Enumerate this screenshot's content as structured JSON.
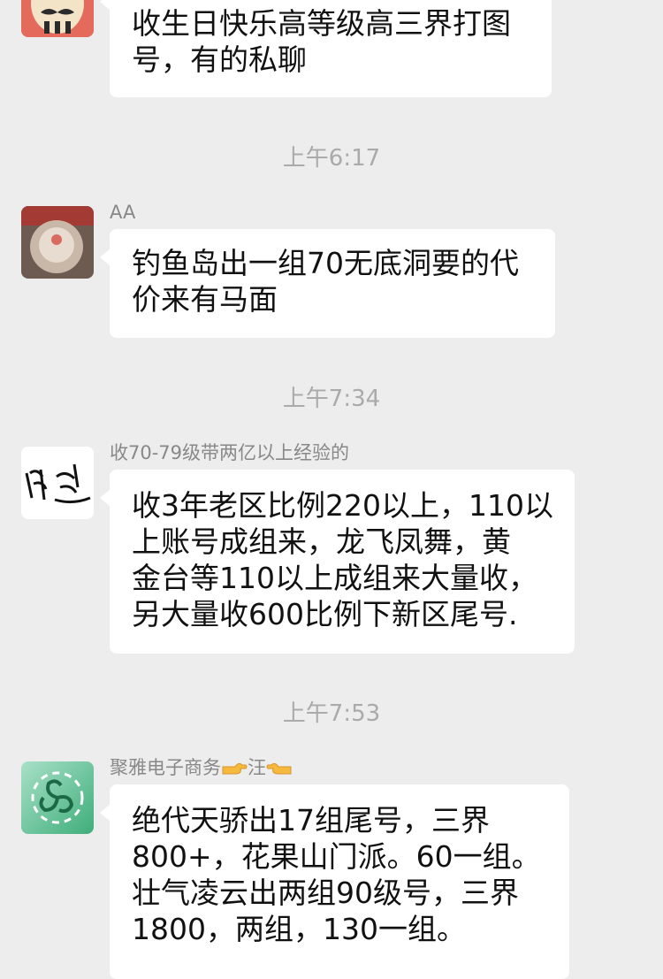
{
  "messages": [
    {
      "sender": "",
      "avatar": "cartoon-face-avatar",
      "lines": [
        "收生日快乐高等级高三界打图",
        "号，有的私聊"
      ]
    },
    {
      "sender": "AA",
      "avatar": "cake-photo-avatar",
      "lines": [
        "钓鱼岛出一组70无底洞要的代",
        "价来有马面"
      ]
    },
    {
      "sender": "收70-79级带两亿以上经验的",
      "avatar": "calligraphy-avatar",
      "lines": [
        "收3年老区比例220以上，110以",
        "上账号成组来，龙飞凤舞，黄",
        "金台等110以上成组来大量收，",
        "另大量收600比例下新区尾号."
      ]
    },
    {
      "sender_prefix": "聚雅电子商务",
      "sender_middle": "汪",
      "avatar": "green-swirl-logo-avatar",
      "lines": [
        "绝代天骄出17组尾号，三界",
        "800+，花果山门派。60一组。",
        "壮气凌云出两组90级号，三界",
        "1800，两组，130一组。"
      ]
    }
  ],
  "timestamps": [
    "上午6:17",
    "上午7:34",
    "上午7:53"
  ],
  "colors": {
    "background": "#ededed",
    "bubble": "#ffffff",
    "timestamp": "#aaaaaa",
    "sender": "#888888"
  }
}
